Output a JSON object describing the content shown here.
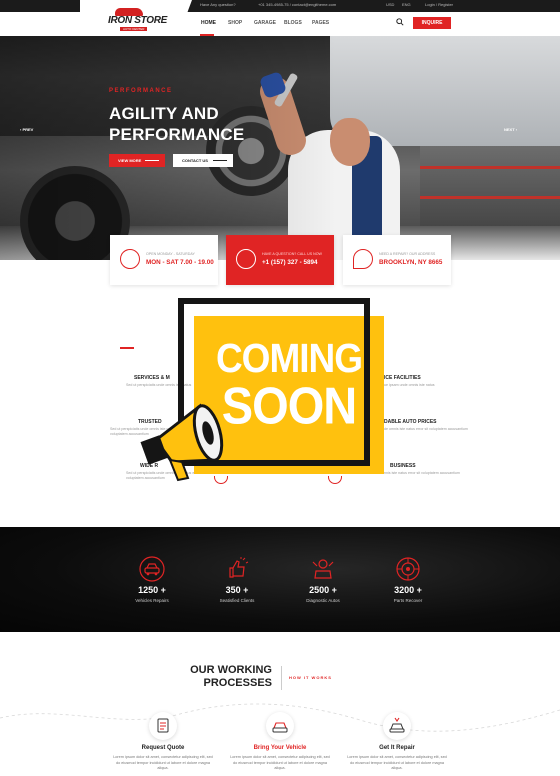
{
  "colors": {
    "accent": "#e02424",
    "dark": "#1b1b1b",
    "coming_soon_yellow": "#ffc10e"
  },
  "topbar": {
    "question": "Have Any question?",
    "contact": "+01 345-4985-75 / contact@engitheme.com",
    "currency": "USD",
    "language": "ENG",
    "login": "Login / Register"
  },
  "logo": {
    "name": "IRON STORE",
    "tagline": "AUTO CENTER"
  },
  "nav": {
    "items": [
      {
        "label": "HOME"
      },
      {
        "label": "SHOP"
      },
      {
        "label": "GARAGE"
      },
      {
        "label": "BLOGS"
      },
      {
        "label": "PAGES"
      }
    ],
    "inquire": "INQUIRE"
  },
  "hero": {
    "eyebrow": "PERFORMANCE",
    "title_line1": "AGILITY AND",
    "title_line2": "PERFORMANCE",
    "view_more": "VIEW MORE",
    "contact_us": "CONTACT US",
    "prev": "PREV",
    "next": "NEXT"
  },
  "info": [
    {
      "label": "OPEN MONDAY - SATURDAY",
      "value": "MON - SAT 7.00 - 19.00",
      "icon": "clock-badge-icon"
    },
    {
      "label": "HAVE A QUESTION? CALL US NOW",
      "value": "+1 (157) 327 - 5894",
      "icon": "headset-icon"
    },
    {
      "label": "NEED A REPAIR? OUR ADDRESS",
      "value": "BROOKLYN, NY 8665",
      "icon": "map-pin-icon"
    }
  ],
  "services": {
    "left": [
      {
        "title": "SERVICES & M",
        "desc": "Sed ut perspiciatis unde omnis iste natus"
      },
      {
        "title": "TRUSTED",
        "desc": "Sed ut perspiciatis unde omnis iste natus error sit voluptatem accusantium"
      },
      {
        "title": "WIDE R",
        "desc": "Sed ut perspiciatis unde omnis iste natus error sit voluptatem accusantium"
      }
    ],
    "right": [
      {
        "title": "ICE FACILITIES",
        "desc": "ue ipsam unde omnis iste natus"
      },
      {
        "title": "DABLE AUTO PRICES",
        "desc": "de omnis iste natus error sit voluptatem accusantium"
      },
      {
        "title": "BUSINESS",
        "desc": "unde omnis iste natus error sit voluptatem accusantium"
      }
    ]
  },
  "coming_soon": {
    "line1": "COMING",
    "line2": "SOON"
  },
  "stats": [
    {
      "value": "1250 +",
      "label": "Vehicles Repairs",
      "icon": "car-icon"
    },
    {
      "value": "350 +",
      "label": "Seatisfied Clients",
      "icon": "thumbs-up-icon"
    },
    {
      "value": "2500 +",
      "label": "Diagnostic Autos",
      "icon": "mechanic-icon"
    },
    {
      "value": "3200 +",
      "label": "Parts Recover",
      "icon": "tire-icon"
    }
  ],
  "process": {
    "title_line1": "OUR WORKING",
    "title_line2": "PROCESSES",
    "eyebrow": "HOW IT WORKS",
    "steps": [
      {
        "name": "Request Quote",
        "desc": "Lorem ipsum dolor sit amet, consectetur adipiscing elit, sed do eiusmod tempor incididunt ut labore et dolore magna aliqua.",
        "icon": "quote-doc-icon"
      },
      {
        "name": "Bring Your Vehicle",
        "desc": "Lorem ipsum dolor sit amet, consectetur adipiscing elit, sed do eiusmod tempor incididunt ut labore et dolore magna aliqua.",
        "icon": "car-front-icon"
      },
      {
        "name": "Get It Repair",
        "desc": "Lorem ipsum dolor sit amet, consectetur adipiscing elit, sed do eiusmod tempor incididunt ut labore et dolore magna aliqua.",
        "icon": "repair-car-icon"
      }
    ]
  }
}
